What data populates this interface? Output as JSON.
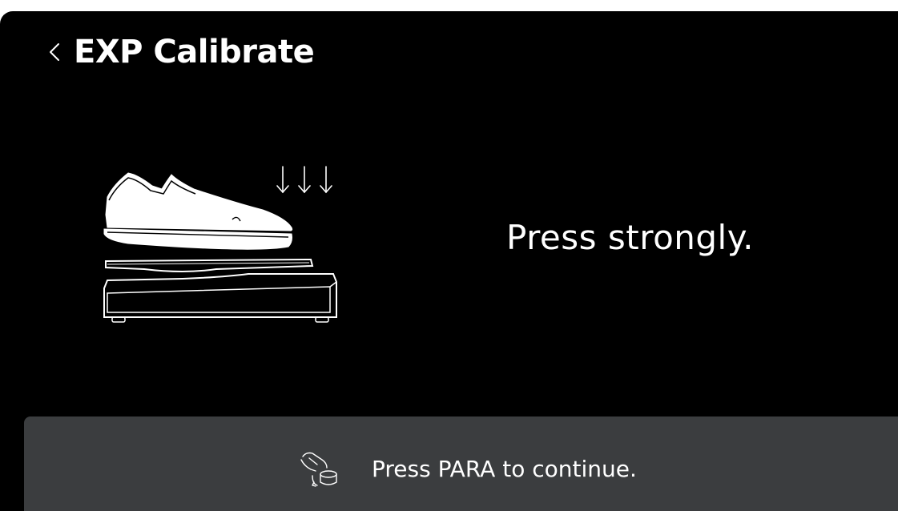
{
  "header": {
    "title": "EXP Calibrate",
    "back_icon": "chevron-left-icon"
  },
  "main": {
    "illustration": "shoe-pressing-expression-pedal-illustration",
    "instruction": "Press strongly."
  },
  "footer": {
    "icon": "hand-turning-knob-icon",
    "hint": "Press PARA to continue."
  },
  "colors": {
    "background": "#000000",
    "footer_background": "#3b3d3f",
    "text": "#ffffff"
  }
}
